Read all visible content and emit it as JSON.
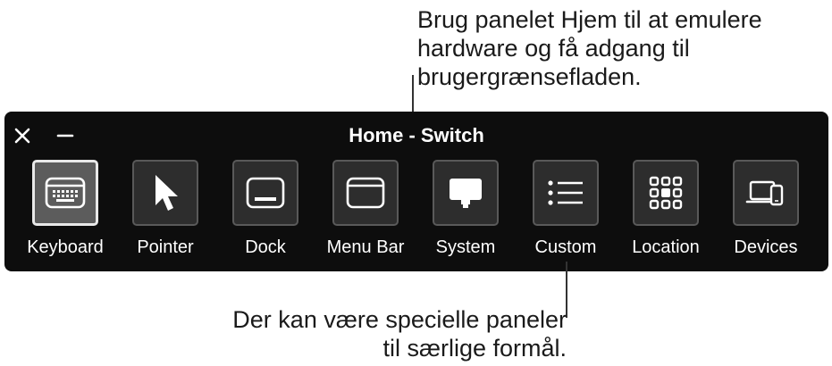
{
  "callouts": {
    "top": "Brug panelet Hjem til at emulere\nhardware og få adgang til\nbrugergrænsefladen.",
    "bottom": "Der kan være specielle paneler\ntil særlige formål."
  },
  "panel": {
    "title": "Home - Switch",
    "controls": [
      "close-icon",
      "minimize-icon"
    ],
    "selected_item": "Keyboard",
    "items": [
      {
        "label": "Keyboard",
        "icon": "keyboard-icon"
      },
      {
        "label": "Pointer",
        "icon": "pointer-arrow-icon"
      },
      {
        "label": "Dock",
        "icon": "dock-icon"
      },
      {
        "label": "Menu Bar",
        "icon": "menu-bar-icon"
      },
      {
        "label": "System",
        "icon": "monitor-icon"
      },
      {
        "label": "Custom",
        "icon": "list-icon"
      },
      {
        "label": "Location",
        "icon": "grid-location-icon"
      },
      {
        "label": "Devices",
        "icon": "devices-icon"
      }
    ],
    "colors": {
      "background": "#0d0d0d",
      "tile": "#2d2d2d",
      "selected_tile": "#5c5c5c",
      "text": "#ffffff"
    }
  }
}
